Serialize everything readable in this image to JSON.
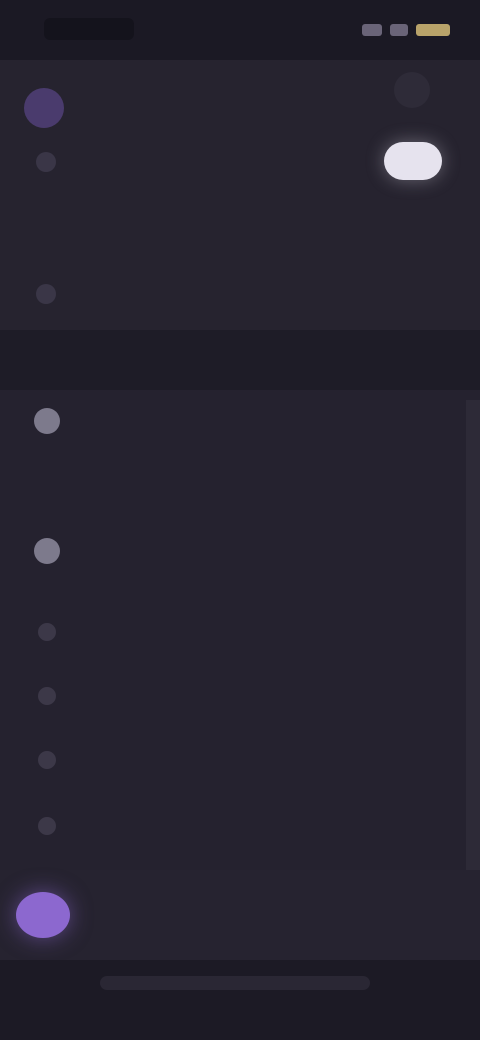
{
  "status_bar": {
    "time": "",
    "icons": [
      "signal-icon",
      "wifi-icon",
      "battery-icon"
    ],
    "battery_color": "#b9a36a"
  },
  "header": {
    "title": "",
    "avatar_color": "#4a3b6d"
  },
  "top_menu": [
    {
      "icon": "user-icon",
      "label": ""
    },
    {
      "icon": "blank",
      "label": ""
    },
    {
      "icon": "info-icon",
      "label": ""
    }
  ],
  "toggle": {
    "state": "on",
    "color": "#e6e3ee"
  },
  "section": {
    "label": ""
  },
  "list_items": [
    {
      "icon": "circle-icon",
      "label": ""
    },
    {
      "icon": "blank",
      "label": ""
    },
    {
      "icon": "circle-icon",
      "label": ""
    },
    {
      "icon": "minus-icon",
      "label": ""
    },
    {
      "icon": "minus-icon",
      "label": ""
    },
    {
      "icon": "minus-icon",
      "label": ""
    },
    {
      "icon": "plus-icon",
      "label": ""
    }
  ],
  "account": {
    "name": "",
    "subtitle": "",
    "avatar_color": "#8c68cf"
  },
  "colors": {
    "background": "#1d1a27",
    "panel": "#26232f",
    "accent": "#8c68cf"
  }
}
